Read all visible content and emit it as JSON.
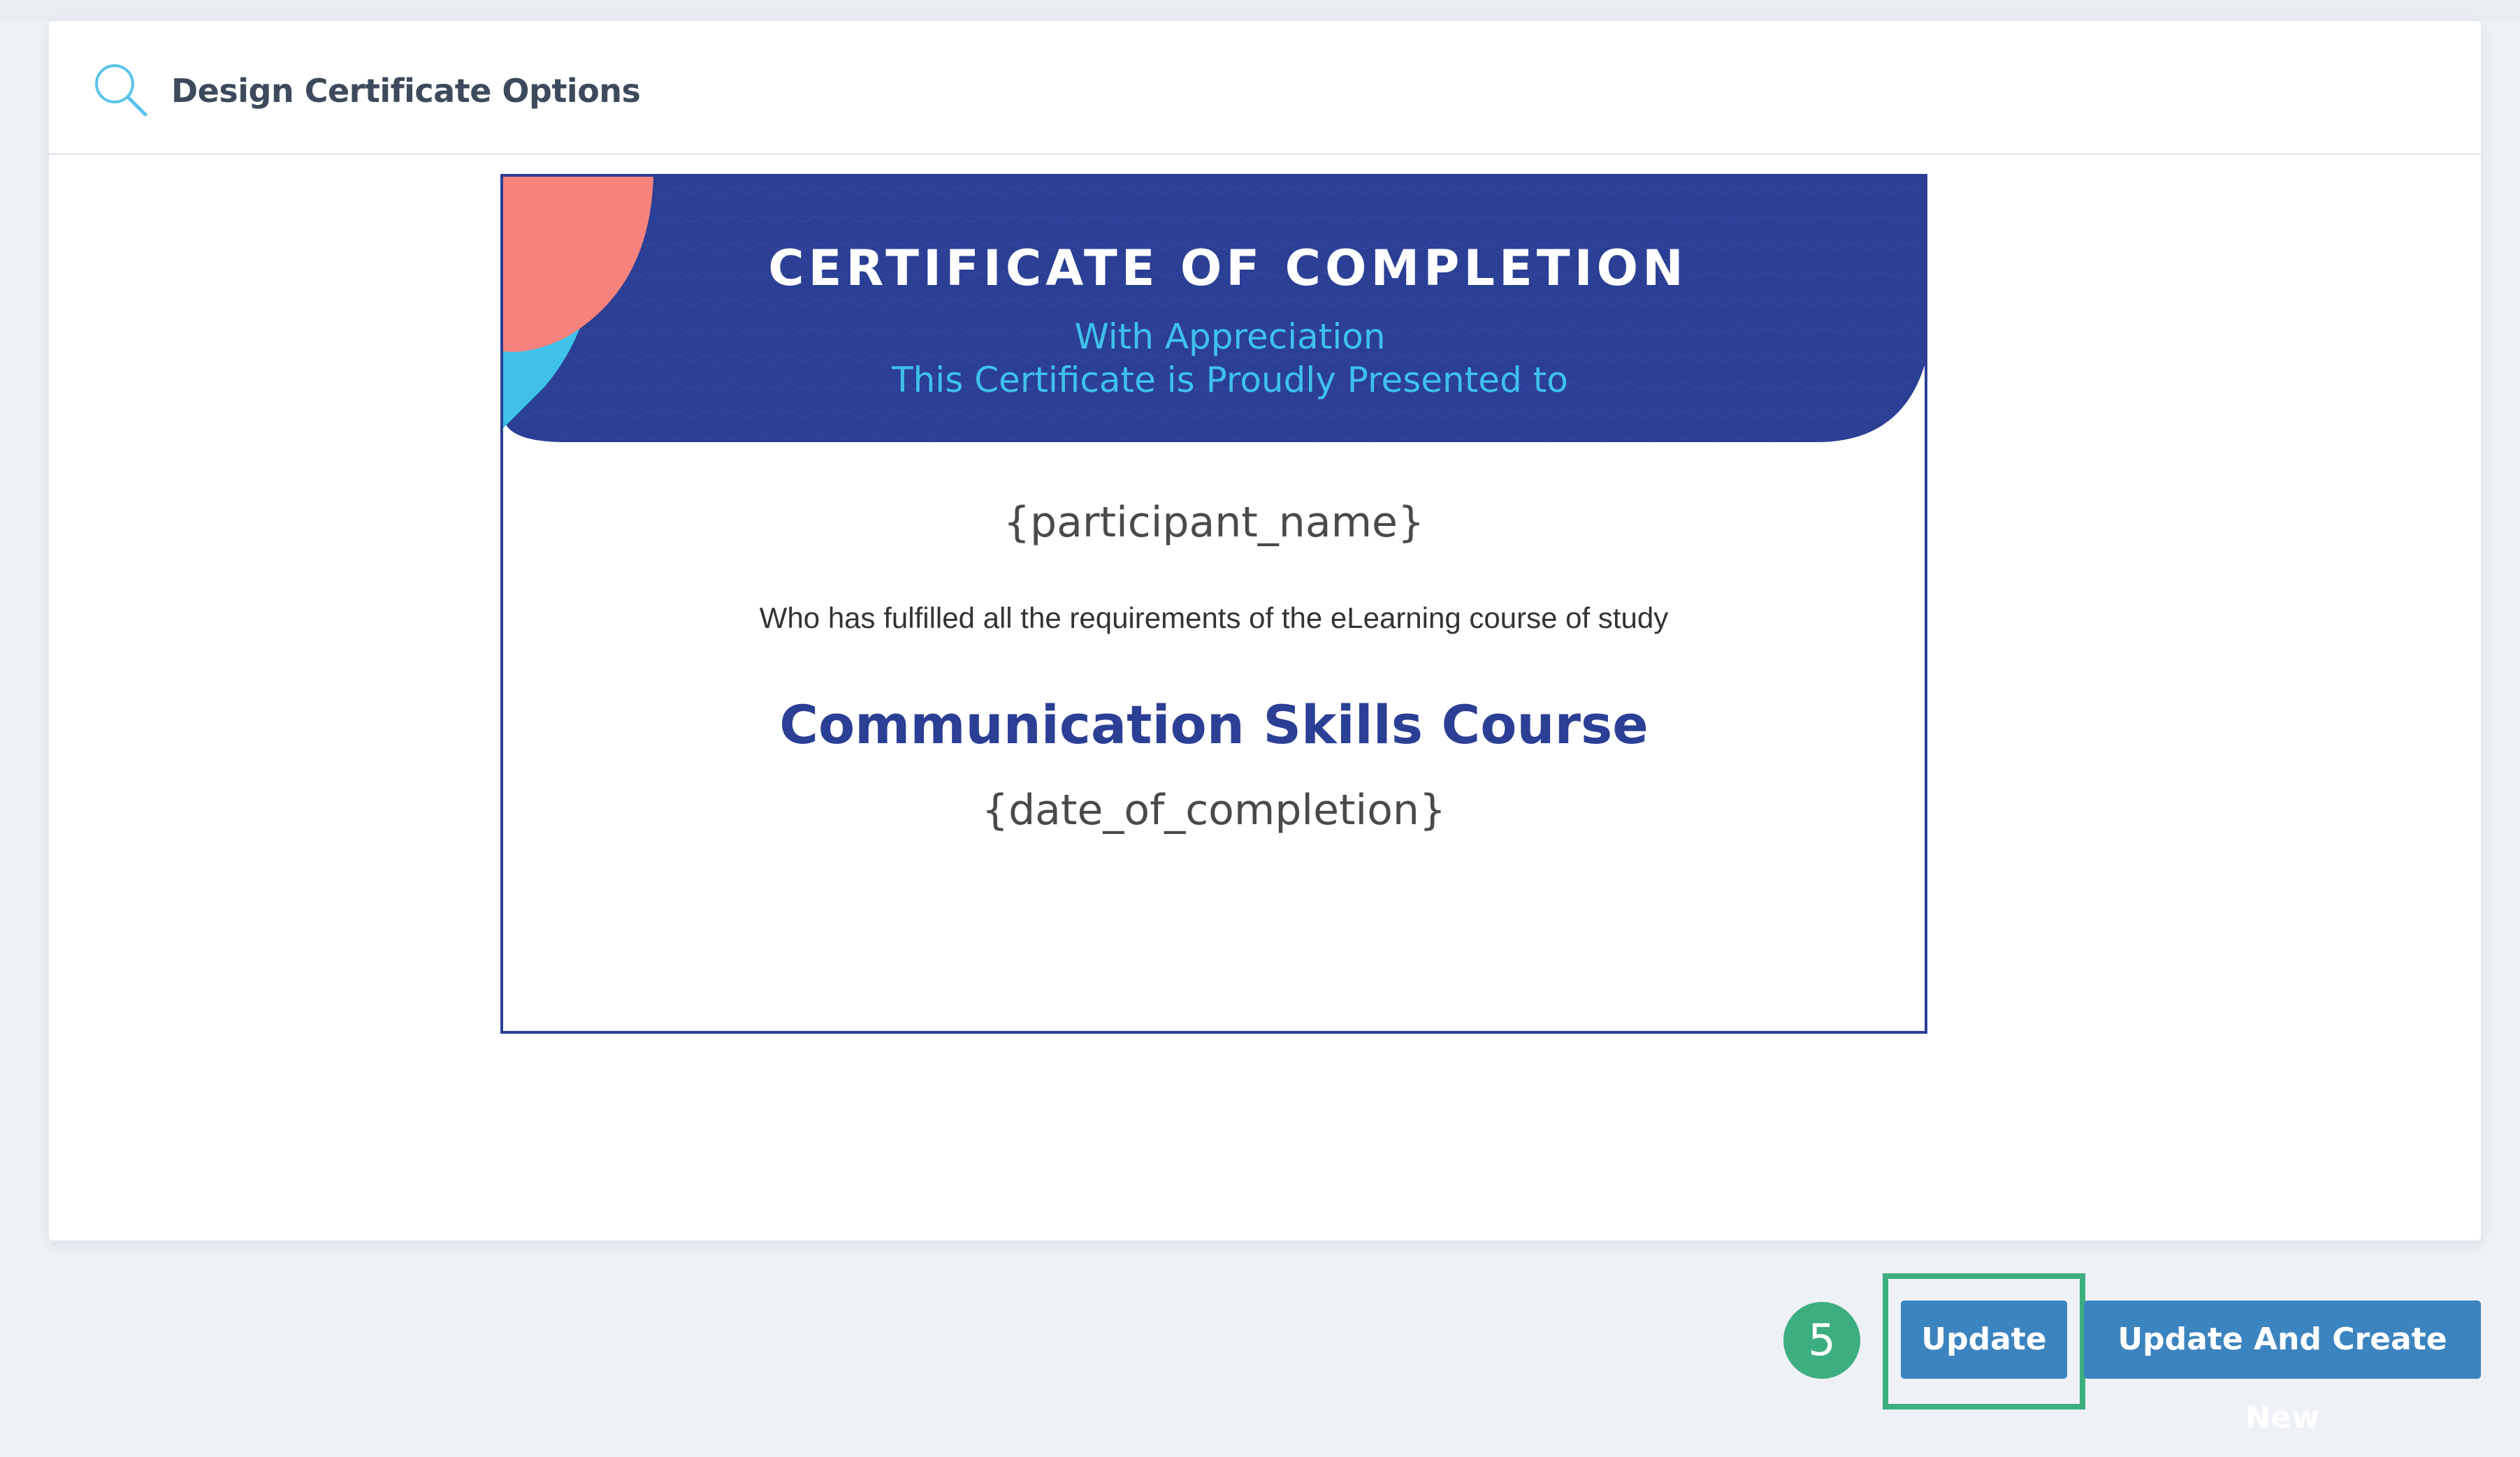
{
  "panel": {
    "title": "Design Certificate Options",
    "icon": "search-icon"
  },
  "certificate": {
    "title": "CERTIFICATE OF COMPLETION",
    "subtitle_line1": "With Appreciation",
    "subtitle_line2": "This Certificate is Proudly Presented to",
    "participant_placeholder": "{participant_name}",
    "body_text": "Who has fulfilled all the requirements of the eLearning course of study",
    "course_name": "Communication Skills Course",
    "date_placeholder": "{date_of_completion}",
    "colors": {
      "banner": "#2b3f95",
      "accent_cyan": "#3fc1ea",
      "accent_coral": "#f5827c",
      "border": "#2b3f95"
    }
  },
  "footer": {
    "step_number": "5",
    "update_label": "Update",
    "update_and_create_new_label": "Update And Create New",
    "colors": {
      "button": "#3c84bf",
      "highlight": "#3dae80"
    }
  }
}
